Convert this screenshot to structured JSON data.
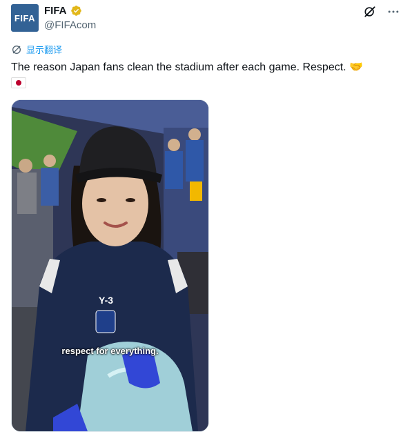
{
  "author": {
    "avatar_text": "FIFA",
    "display_name": "FIFA",
    "handle": "@FIFAcom",
    "brand_color": "#326295",
    "verified_color": "#e2b719"
  },
  "top_icons": [
    "grok-icon",
    "more-icon"
  ],
  "translate": {
    "label": "显示翻译",
    "color": "#1d9bf0"
  },
  "tweet": {
    "text": "The reason Japan fans clean the stadium after each game. Respect. 🤝",
    "flag": "🇯🇵"
  },
  "media": {
    "subtitle": "respect for everything.",
    "shirt_logo": "Y-3"
  }
}
